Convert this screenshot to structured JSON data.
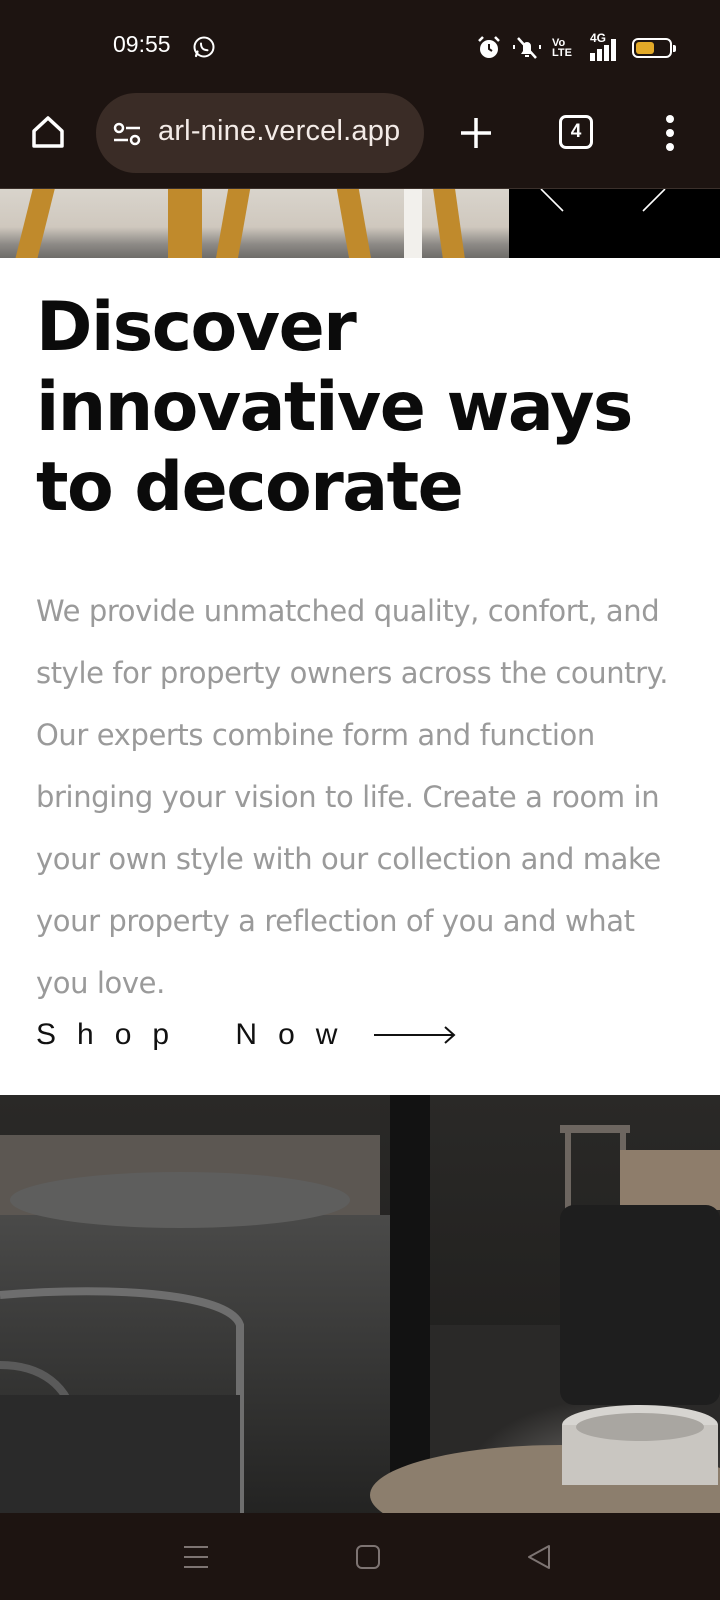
{
  "status_bar": {
    "time": "09:55",
    "volte_top": "Vo",
    "volte_bottom": "LTE",
    "network": "4G",
    "battery_level": 0.55,
    "icons": [
      "whatsapp-icon",
      "alarm-icon",
      "mute-icon",
      "volte-icon",
      "signal-icon",
      "battery-icon"
    ]
  },
  "browser": {
    "url": "arl-nine.vercel.app",
    "tab_count": "4",
    "icons": [
      "home-icon",
      "site-settings-icon",
      "new-tab-icon",
      "tabs-icon",
      "more-menu-icon"
    ]
  },
  "hero": {
    "headline": "Discover innovative ways to decorate",
    "description": "We provide unmatched quality, confort, and style for property owners across the country. Our experts combine form and function bringing your vision to life. Create a room in your own style with our collection and make your property a reflection of you and what you love.",
    "cta_label": "Shop Now"
  },
  "nav_bar": {
    "icons": [
      "recent-apps-icon",
      "home-button-icon",
      "back-icon"
    ]
  },
  "colors": {
    "chrome_bg": "#1d1411",
    "url_bar_bg": "#3a2c26",
    "headline": "#0b0b0b",
    "body_text": "#9a9a9a",
    "battery_fill": "#e2a928"
  }
}
